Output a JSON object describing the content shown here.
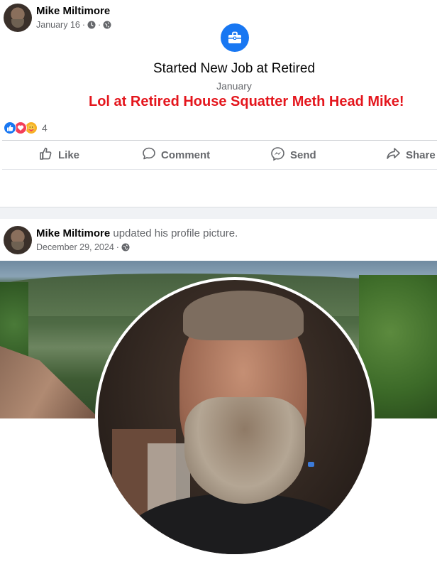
{
  "post1": {
    "author": "Mike Miltimore",
    "date": "January 16",
    "meta_sep": "·",
    "life_event": {
      "title": "Started New Job at Retired",
      "date": "January",
      "badge_icon": "briefcase-icon",
      "badge_color": "#1877f2"
    },
    "overlay_text": "Lol at Retired House Squatter Meth Head Mike!",
    "overlay_color": "#e4161d",
    "reactions": {
      "icons": [
        "like-reaction-icon",
        "love-reaction-icon",
        "care-reaction-icon"
      ],
      "count": "4"
    },
    "actions": [
      {
        "label": "Like",
        "icon": "thumbs-up-icon"
      },
      {
        "label": "Comment",
        "icon": "comment-bubble-icon"
      },
      {
        "label": "Send",
        "icon": "messenger-icon"
      },
      {
        "label": "Share",
        "icon": "share-arrow-icon"
      }
    ]
  },
  "post2": {
    "author": "Mike Miltimore",
    "action_text": "updated his profile picture.",
    "date": "December 29, 2024",
    "meta_sep": "·"
  }
}
